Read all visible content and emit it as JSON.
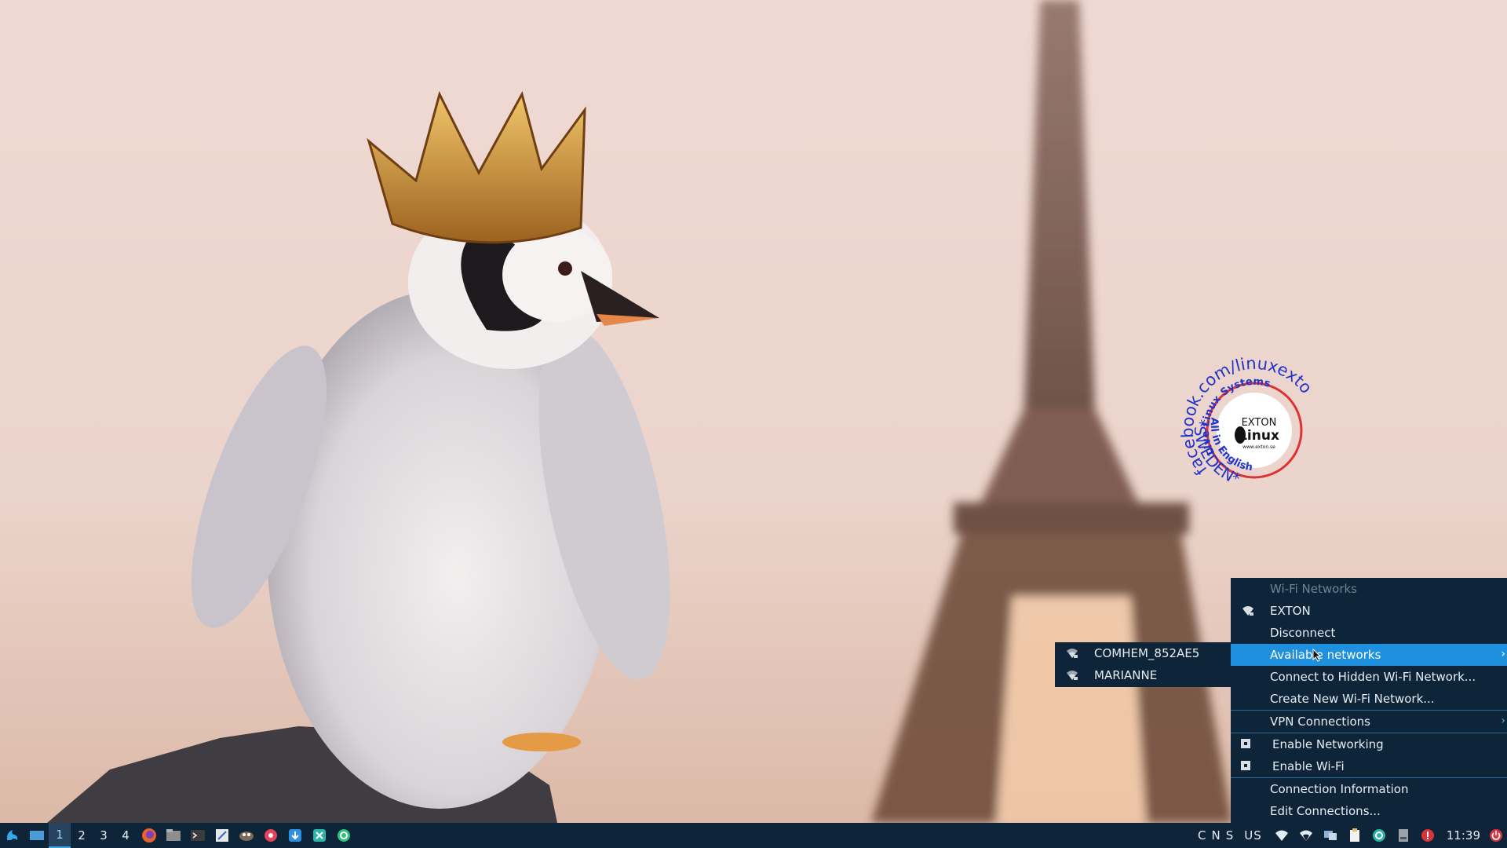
{
  "stamp": {
    "outer_text": "facebook.com/linuxexton",
    "inner_text": "Live Linux Systems",
    "bottom_text": "*SWEDEN*",
    "inner_bottom_text": "All in English",
    "logo_line1": "EXTON",
    "logo_line2": "Linux",
    "logo_url": "www.exton.se"
  },
  "taskbar": {
    "workspaces": [
      "1",
      "2",
      "3",
      "4"
    ],
    "active_workspace": "1",
    "tray_indicators": [
      "C",
      "N",
      "S"
    ],
    "keyboard_layout": "US",
    "clock": "11:39",
    "icons": [
      "start-menu-icon",
      "show-desktop-icon",
      "firefox-icon",
      "file-manager-icon",
      "terminal-icon",
      "text-editor-icon",
      "gimp-icon",
      "red-app-icon",
      "blue-app-icon",
      "settings-tool-icon",
      "green-sync-icon"
    ],
    "accent": "#3aa8e6",
    "bg": "#0e2438"
  },
  "network_menu": {
    "header": "Wi-Fi Networks",
    "connected": "EXTON",
    "disconnect": "Disconnect",
    "available_networks": "Available networks",
    "connect_hidden": "Connect to Hidden Wi-Fi Network...",
    "create_new": "Create New Wi-Fi Network...",
    "vpn": "VPN Connections",
    "enable_networking": "Enable Networking",
    "enable_wifi": "Enable Wi-Fi",
    "connection_info": "Connection Information",
    "edit_connections": "Edit Connections...",
    "highlight": "#1e90dd"
  },
  "available_submenu": {
    "networks": [
      "COMHEM_852AE5",
      "MARIANNE"
    ]
  }
}
